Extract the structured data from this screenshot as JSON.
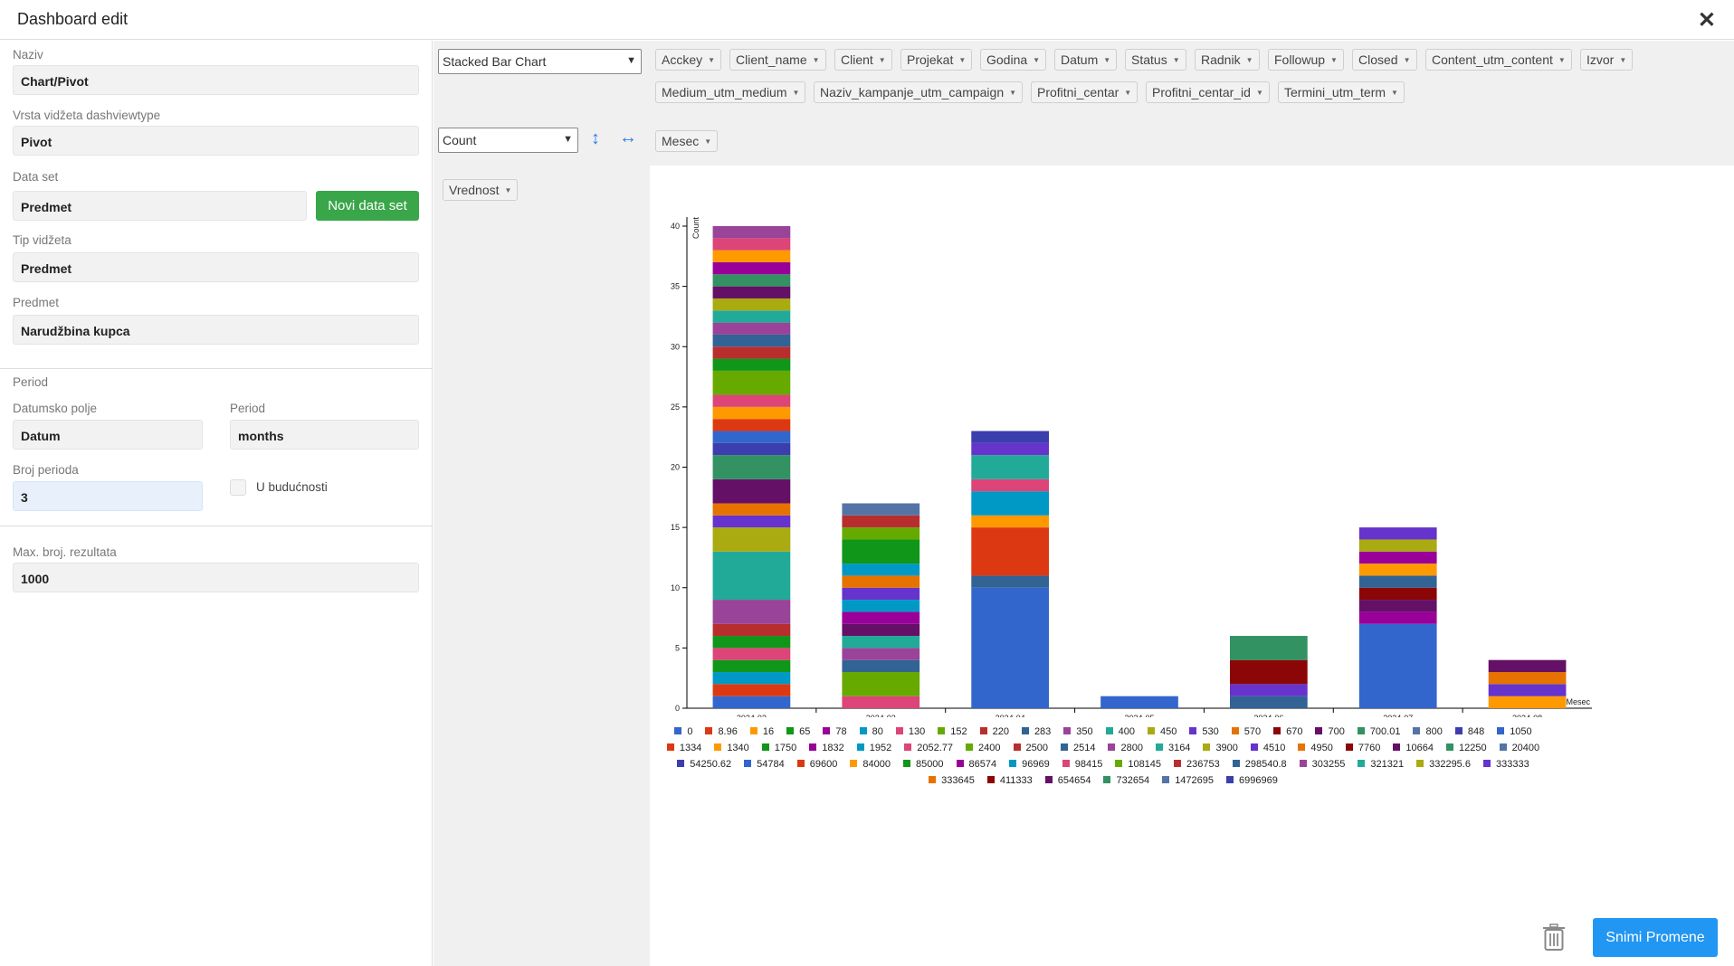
{
  "header": {
    "title": "Dashboard edit",
    "close_icon": "close-icon"
  },
  "form": {
    "naziv_label": "Naziv",
    "naziv_value": "Chart/Pivot",
    "vrsta_label": "Vrsta vidžeta dashviewtype",
    "vrsta_value": "Pivot",
    "dataset_label": "Data set",
    "dataset_value": "Predmet",
    "novi_btn": "Novi data set",
    "tip_label": "Tip vidžeta",
    "tip_value": "Predmet",
    "predmet_label": "Predmet",
    "predmet_value": "Narudžbina kupca",
    "period_section": "Period",
    "datumsko_label": "Datumsko polje",
    "datumsko_value": "Datum",
    "period_label": "Period",
    "period_value": "months",
    "broj_label": "Broj perioda",
    "broj_value": "3",
    "buducnosti_label": "U budućnosti",
    "max_label": "Max. broj. rezultata",
    "max_value": "1000"
  },
  "pivot": {
    "renderer": "Stacked Bar Chart",
    "aggregator": "Count",
    "attrs_row1": [
      "Acckey",
      "Client_name",
      "Client",
      "Projekat",
      "Godina",
      "Datum",
      "Status",
      "Radnik",
      "Followup",
      "Closed",
      "Content_utm_content",
      "Izvor"
    ],
    "attrs_row2": [
      "Medium_utm_medium",
      "Naziv_kampanje_utm_campaign",
      "Profitni_centar",
      "Profitni_centar_id",
      "Termini_utm_term"
    ],
    "col_attr": "Mesec",
    "row_attr": "Vrednost"
  },
  "buttons": {
    "save": "Snimi Promene",
    "trash_icon": "trash-icon"
  },
  "chart_data": {
    "type": "bar",
    "stacked": true,
    "ylabel": "Count",
    "xlabel": "Mesec",
    "ylim": [
      0,
      40
    ],
    "yticks": [
      "0",
      "5",
      "10",
      "15",
      "20",
      "25",
      "30",
      "35",
      "40"
    ],
    "categories": [
      "2024-02",
      "2024-03",
      "2024-04",
      "2024-05",
      "2024-06",
      "2024-07",
      "2024-08"
    ],
    "palette": [
      "#3366cc",
      "#dc3912",
      "#ff9900",
      "#109618",
      "#990099",
      "#0099c6",
      "#dd4477",
      "#66aa00",
      "#b82e2e",
      "#316395",
      "#994499",
      "#22aa99",
      "#aaaa11",
      "#6633cc",
      "#e67300",
      "#8b0707",
      "#651067",
      "#329262",
      "#5574a6",
      "#3b3eac"
    ],
    "legend": [
      "0",
      "8.96",
      "16",
      "65",
      "78",
      "80",
      "130",
      "152",
      "220",
      "283",
      "350",
      "400",
      "450",
      "530",
      "570",
      "670",
      "700",
      "700.01",
      "800",
      "848",
      "1050",
      "1334",
      "1340",
      "1750",
      "1832",
      "1952",
      "2052.77",
      "2400",
      "2500",
      "2514",
      "2800",
      "3164",
      "3900",
      "4510",
      "4950",
      "7760",
      "10664",
      "12250",
      "20400",
      "54250.62",
      "54784",
      "69600",
      "84000",
      "85000",
      "86574",
      "96969",
      "98415",
      "108145",
      "236753",
      "298540.8",
      "303255",
      "321321",
      "332295.6",
      "333333",
      "333645",
      "411333",
      "654654",
      "732654",
      "1472695",
      "6996969"
    ],
    "stacks": [
      [
        [
          0,
          1
        ],
        [
          1,
          1
        ],
        [
          5,
          1
        ],
        [
          3,
          1
        ],
        [
          6,
          1
        ],
        [
          3,
          1
        ],
        [
          8,
          1
        ],
        [
          10,
          2
        ],
        [
          11,
          4
        ],
        [
          12,
          2
        ],
        [
          13,
          1
        ],
        [
          14,
          1
        ],
        [
          16,
          2
        ],
        [
          17,
          2
        ],
        [
          19,
          1
        ],
        [
          20,
          1
        ],
        [
          21,
          1
        ],
        [
          22,
          1
        ],
        [
          6,
          1
        ],
        [
          7,
          2
        ],
        [
          3,
          1
        ],
        [
          8,
          1
        ],
        [
          9,
          1
        ],
        [
          10,
          1
        ],
        [
          11,
          1
        ],
        [
          12,
          1
        ],
        [
          16,
          1
        ],
        [
          17,
          1
        ],
        [
          4,
          1
        ],
        [
          2,
          1
        ],
        [
          6,
          1
        ],
        [
          10,
          1
        ]
      ],
      [
        [
          6,
          1
        ],
        [
          7,
          2
        ],
        [
          9,
          1
        ],
        [
          10,
          1
        ],
        [
          11,
          1
        ],
        [
          16,
          1
        ],
        [
          4,
          1
        ],
        [
          5,
          1
        ],
        [
          13,
          1
        ],
        [
          14,
          1
        ],
        [
          5,
          1
        ],
        [
          3,
          2
        ],
        [
          7,
          1
        ],
        [
          8,
          1
        ],
        [
          18,
          1
        ]
      ],
      [
        [
          0,
          10
        ],
        [
          9,
          1
        ],
        [
          1,
          4
        ],
        [
          2,
          1
        ],
        [
          5,
          2
        ],
        [
          6,
          1
        ],
        [
          11,
          2
        ],
        [
          13,
          1
        ],
        [
          19,
          1
        ]
      ],
      [
        [
          0,
          1
        ]
      ],
      [
        [
          9,
          1
        ],
        [
          13,
          1
        ],
        [
          15,
          2
        ],
        [
          17,
          2
        ]
      ],
      [
        [
          0,
          7
        ],
        [
          4,
          1
        ],
        [
          16,
          1
        ],
        [
          15,
          1
        ],
        [
          9,
          1
        ],
        [
          2,
          1
        ],
        [
          4,
          1
        ],
        [
          12,
          1
        ],
        [
          13,
          1
        ]
      ],
      [
        [
          2,
          1
        ],
        [
          13,
          1
        ],
        [
          14,
          1
        ],
        [
          16,
          1
        ]
      ]
    ]
  }
}
